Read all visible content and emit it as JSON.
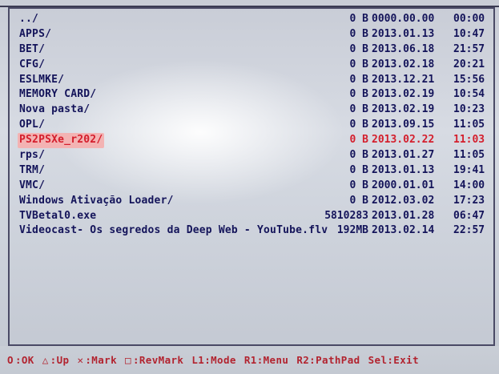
{
  "topbar": {
    "title": ""
  },
  "entries": [
    {
      "name": "../",
      "size": "0 B",
      "date": "0000.00.00",
      "time": "00:00"
    },
    {
      "name": "APPS/",
      "size": "0 B",
      "date": "2013.01.13",
      "time": "10:47"
    },
    {
      "name": "BET/",
      "size": "0 B",
      "date": "2013.06.18",
      "time": "21:57"
    },
    {
      "name": "CFG/",
      "size": "0 B",
      "date": "2013.02.18",
      "time": "20:21"
    },
    {
      "name": "ESLMKE/",
      "size": "0 B",
      "date": "2013.12.21",
      "time": "15:56"
    },
    {
      "name": "MEMORY CARD/",
      "size": "0 B",
      "date": "2013.02.19",
      "time": "10:54"
    },
    {
      "name": "Nova pasta/",
      "size": "0 B",
      "date": "2013.02.19",
      "time": "10:23"
    },
    {
      "name": "OPL/",
      "size": "0 B",
      "date": "2013.09.15",
      "time": "11:05"
    },
    {
      "name": "PS2PSXe_r202/",
      "size": "0 B",
      "date": "2013.02.22",
      "time": "11:03",
      "selected": true
    },
    {
      "name": "rps/",
      "size": "0 B",
      "date": "2013.01.27",
      "time": "11:05"
    },
    {
      "name": "TRM/",
      "size": "0 B",
      "date": "2013.01.13",
      "time": "19:41"
    },
    {
      "name": "VMC/",
      "size": "0 B",
      "date": "2000.01.01",
      "time": "14:00"
    },
    {
      "name": "Windows Ativação Loader/",
      "size": "0 B",
      "date": "2012.03.02",
      "time": "17:23"
    },
    {
      "name": "TVBetal0.exe",
      "size": "5810283",
      "date": "2013.01.28",
      "time": "06:47"
    },
    {
      "name": "Videocast- Os segredos da Deep Web - YouTube.flv",
      "size": "192MB",
      "date": "2013.02.14",
      "time": "22:57"
    }
  ],
  "footer": {
    "items": [
      {
        "symbol": "O",
        "label": ":OK"
      },
      {
        "symbol": "△",
        "label": ":Up"
      },
      {
        "symbol": "✕",
        "label": ":Mark"
      },
      {
        "symbol": "□",
        "label": ":RevMark"
      },
      {
        "symbol": "",
        "label": "L1:Mode"
      },
      {
        "symbol": "",
        "label": "R1:Menu"
      },
      {
        "symbol": "",
        "label": "R2:PathPad"
      },
      {
        "symbol": "",
        "label": "Sel:Exit"
      }
    ]
  },
  "colors": {
    "text": "#14145a",
    "selected_text": "#d41e2c",
    "footer_text": "#b2232f",
    "frame": "#4a4a66"
  }
}
